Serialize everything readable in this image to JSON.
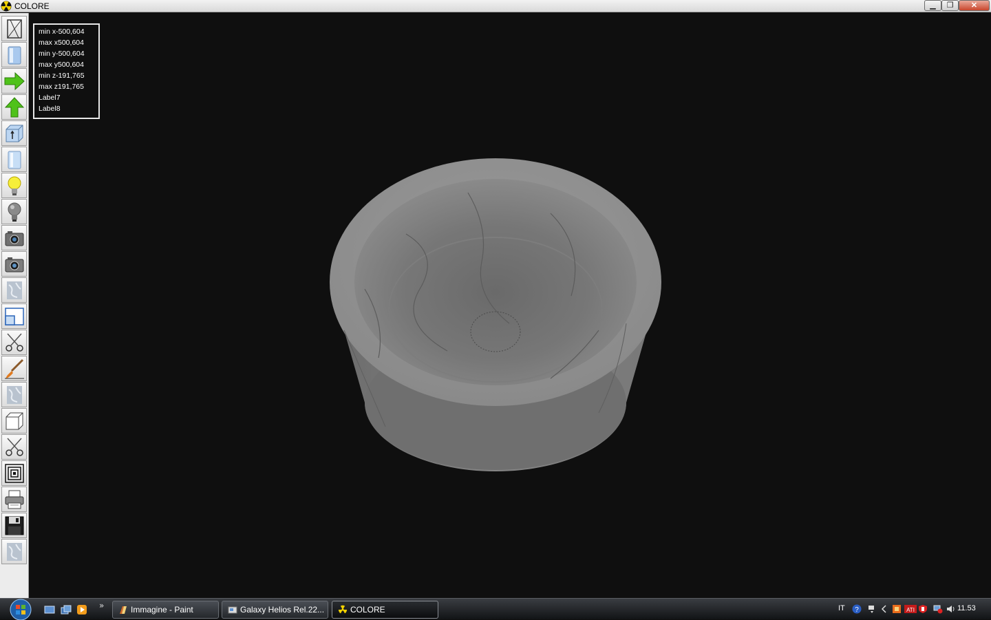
{
  "window": {
    "title": "COLORE",
    "minimize": "▁",
    "restore": "❐",
    "close": "✕"
  },
  "toolbar": {
    "tools": [
      {
        "icon": "wireframe-cylinder-icon"
      },
      {
        "icon": "solid-cylinder-icon"
      },
      {
        "icon": "arrow-right-icon"
      },
      {
        "icon": "arrow-up-icon"
      },
      {
        "icon": "extrude-cube-icon"
      },
      {
        "icon": "cylinder-light-icon"
      },
      {
        "icon": "light-bulb-on-icon"
      },
      {
        "icon": "light-bulb-off-icon"
      },
      {
        "icon": "camera-icon"
      },
      {
        "icon": "camera-alt-icon"
      },
      {
        "icon": "marble-texture-icon"
      },
      {
        "icon": "window-view-icon"
      },
      {
        "icon": "scissors-icon"
      },
      {
        "icon": "paint-brush-icon"
      },
      {
        "icon": "marble-texture-alt-icon"
      },
      {
        "icon": "cube-icon"
      },
      {
        "icon": "scissors-alt-icon"
      },
      {
        "icon": "concentric-squares-icon"
      },
      {
        "icon": "printer-icon"
      },
      {
        "icon": "floppy-disk-icon"
      },
      {
        "icon": "marble-texture-third-icon"
      }
    ]
  },
  "info": {
    "min_x": "min x-500,604",
    "max_x": "max x500,604",
    "min_y": "min y-500,604",
    "max_y": "max y500,604",
    "min_z": "min z-191,765",
    "max_z": "max z191,765",
    "label7": "Label7",
    "label8": "Label8"
  },
  "taskbar": {
    "more": "»",
    "tasks": [
      {
        "label": "Immagine - Paint"
      },
      {
        "label": "Galaxy Helios  Rel.22..."
      },
      {
        "label": "COLORE"
      }
    ],
    "tray": {
      "language": "IT",
      "clock": "11.53"
    }
  },
  "colors": {
    "viewport_bg": "#0f0f0f",
    "marble": "#8e8e8e"
  }
}
